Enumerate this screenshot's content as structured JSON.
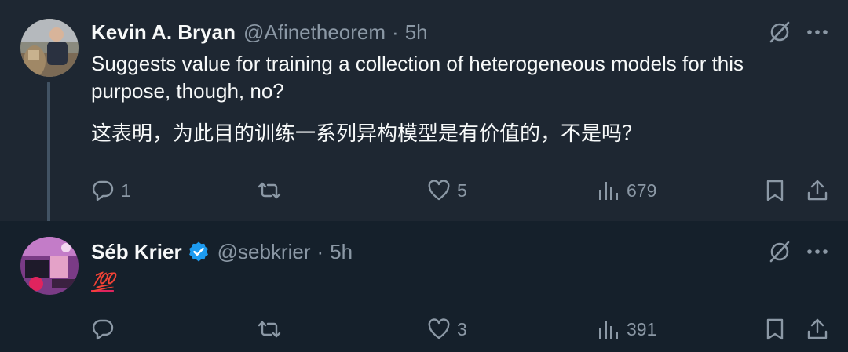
{
  "tweets": [
    {
      "author": "Kevin A. Bryan",
      "handle": "@Afinetheorem",
      "separator": "·",
      "time": "5h",
      "text_en": "Suggests value for training a collection of heterogeneous models for this purpose, though, no?",
      "text_zh": "这表明，为此目的训练一系列异构模型是有价值的，不是吗？",
      "replies": "1",
      "retweets": "",
      "likes": "5",
      "views": "679"
    },
    {
      "author": "Séb Krier",
      "handle": "@sebkrier",
      "separator": "·",
      "time": "5h",
      "verified": true,
      "text": "💯",
      "replies": "",
      "retweets": "",
      "likes": "3",
      "views": "391"
    }
  ],
  "colors": {
    "background": "#15202b",
    "highlight_background": "#1e2732",
    "text": "#f7f9f9",
    "muted": "#8b98a5",
    "verified": "#1d9bf0",
    "hundred_emoji": "#e0245e"
  },
  "icons": [
    "reply-icon",
    "retweet-icon",
    "like-icon",
    "views-icon",
    "bookmark-icon",
    "share-icon",
    "grok-icon",
    "more-icon",
    "verified-badge-icon"
  ]
}
